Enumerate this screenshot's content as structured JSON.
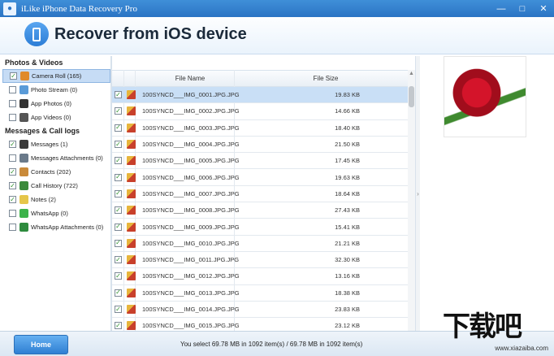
{
  "window": {
    "title": "iLike iPhone Data Recovery Pro",
    "controls": [
      "—",
      "□",
      "✕"
    ]
  },
  "header": {
    "title": "Recover from iOS device"
  },
  "sidebar": {
    "sections": [
      {
        "title": "Photos & Videos",
        "items": [
          {
            "label": "Camera Roll (165)",
            "checked": true,
            "selected": true,
            "icon": "flower-icon",
            "color": "#e08a2a"
          },
          {
            "label": "Photo Stream (0)",
            "checked": false,
            "selected": false,
            "icon": "photo-stream-icon",
            "color": "#5a9bd8"
          },
          {
            "label": "App Photos (0)",
            "checked": false,
            "selected": false,
            "icon": "camera-icon",
            "color": "#333333"
          },
          {
            "label": "App Videos (0)",
            "checked": false,
            "selected": false,
            "icon": "video-icon",
            "color": "#555555"
          }
        ]
      },
      {
        "title": "Messages & Call logs",
        "items": [
          {
            "label": "Messages (1)",
            "checked": true,
            "selected": false,
            "icon": "message-icon",
            "color": "#3a3a3a"
          },
          {
            "label": "Messages Attachments (0)",
            "checked": false,
            "selected": false,
            "icon": "attachment-icon",
            "color": "#6a7a8a"
          },
          {
            "label": "Contacts (202)",
            "checked": true,
            "selected": false,
            "icon": "contacts-icon",
            "color": "#c98a3a"
          },
          {
            "label": "Call History (722)",
            "checked": true,
            "selected": false,
            "icon": "phone-icon",
            "color": "#3b8a3b"
          },
          {
            "label": "Notes (2)",
            "checked": true,
            "selected": false,
            "icon": "notes-icon",
            "color": "#e5c64a"
          },
          {
            "label": "WhatsApp (0)",
            "checked": false,
            "selected": false,
            "icon": "whatsapp-icon",
            "color": "#3cb34a"
          },
          {
            "label": "WhatsApp Attachments (0)",
            "checked": false,
            "selected": false,
            "icon": "whatsapp-attachment-icon",
            "color": "#2e8b3e"
          }
        ]
      }
    ]
  },
  "table": {
    "columns": {
      "name": "File Name",
      "size": "File Size"
    },
    "rows": [
      {
        "name": "100SYNCD___IMG_0001.JPG.JPG",
        "size": "19.83 KB",
        "checked": true,
        "selected": true
      },
      {
        "name": "100SYNCD___IMG_0002.JPG.JPG",
        "size": "14.66 KB",
        "checked": true,
        "selected": false
      },
      {
        "name": "100SYNCD___IMG_0003.JPG.JPG",
        "size": "18.40 KB",
        "checked": true,
        "selected": false
      },
      {
        "name": "100SYNCD___IMG_0004.JPG.JPG",
        "size": "21.50 KB",
        "checked": true,
        "selected": false
      },
      {
        "name": "100SYNCD___IMG_0005.JPG.JPG",
        "size": "17.45 KB",
        "checked": true,
        "selected": false
      },
      {
        "name": "100SYNCD___IMG_0006.JPG.JPG",
        "size": "19.63 KB",
        "checked": true,
        "selected": false
      },
      {
        "name": "100SYNCD___IMG_0007.JPG.JPG",
        "size": "18.64 KB",
        "checked": true,
        "selected": false
      },
      {
        "name": "100SYNCD___IMG_0008.JPG.JPG",
        "size": "27.43 KB",
        "checked": true,
        "selected": false
      },
      {
        "name": "100SYNCD___IMG_0009.JPG.JPG",
        "size": "15.41 KB",
        "checked": true,
        "selected": false
      },
      {
        "name": "100SYNCD___IMG_0010.JPG.JPG",
        "size": "21.21 KB",
        "checked": true,
        "selected": false
      },
      {
        "name": "100SYNCD___IMG_0011.JPG.JPG",
        "size": "32.30 KB",
        "checked": true,
        "selected": false
      },
      {
        "name": "100SYNCD___IMG_0012.JPG.JPG",
        "size": "13.16 KB",
        "checked": true,
        "selected": false
      },
      {
        "name": "100SYNCD___IMG_0013.JPG.JPG",
        "size": "18.38 KB",
        "checked": true,
        "selected": false
      },
      {
        "name": "100SYNCD___IMG_0014.JPG.JPG",
        "size": "23.83 KB",
        "checked": true,
        "selected": false
      },
      {
        "name": "100SYNCD___IMG_0015.JPG.JPG",
        "size": "23.12 KB",
        "checked": true,
        "selected": false
      }
    ]
  },
  "preview": {
    "image": "red-rose-photo"
  },
  "footer": {
    "home_label": "Home",
    "status": "You select 69.78 MB in 1092 item(s) / 69.78 MB in 1092 item(s)"
  },
  "watermark": {
    "logo": "下载吧",
    "url": "www.xiazaiba.com"
  }
}
